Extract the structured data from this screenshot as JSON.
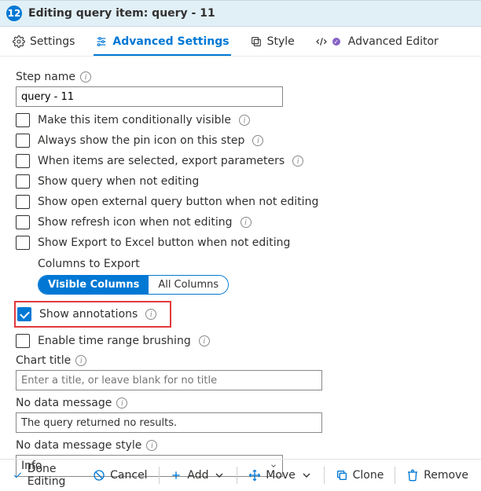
{
  "header": {
    "step_number": "12",
    "title": "Editing query item: query - 11"
  },
  "tabs": {
    "settings": "Settings",
    "advanced": "Advanced Settings",
    "style": "Style",
    "advanced_editor": "Advanced Editor"
  },
  "step_name": {
    "label": "Step name",
    "value": "query - 11"
  },
  "options": {
    "conditional": "Make this item conditionally visible",
    "pin": "Always show the pin icon on this step",
    "export_params": "When items are selected, export parameters",
    "show_query": "Show query when not editing",
    "open_external": "Show open external query button when not editing",
    "refresh_icon": "Show refresh icon when not editing",
    "export_excel": "Show Export to Excel button when not editing"
  },
  "columns_export": {
    "label": "Columns to Export",
    "visible": "Visible Columns",
    "all": "All Columns"
  },
  "annotations": {
    "show": "Show annotations",
    "brushing": "Enable time range brushing"
  },
  "chart_title": {
    "label": "Chart title",
    "placeholder": "Enter a title, or leave blank for no title"
  },
  "no_data_msg": {
    "label": "No data message",
    "value": "The query returned no results."
  },
  "no_data_style": {
    "label": "No data message style",
    "value": "Info"
  },
  "footer": {
    "done": "Done Editing",
    "cancel": "Cancel",
    "add": "Add",
    "move": "Move",
    "clone": "Clone",
    "remove": "Remove"
  }
}
